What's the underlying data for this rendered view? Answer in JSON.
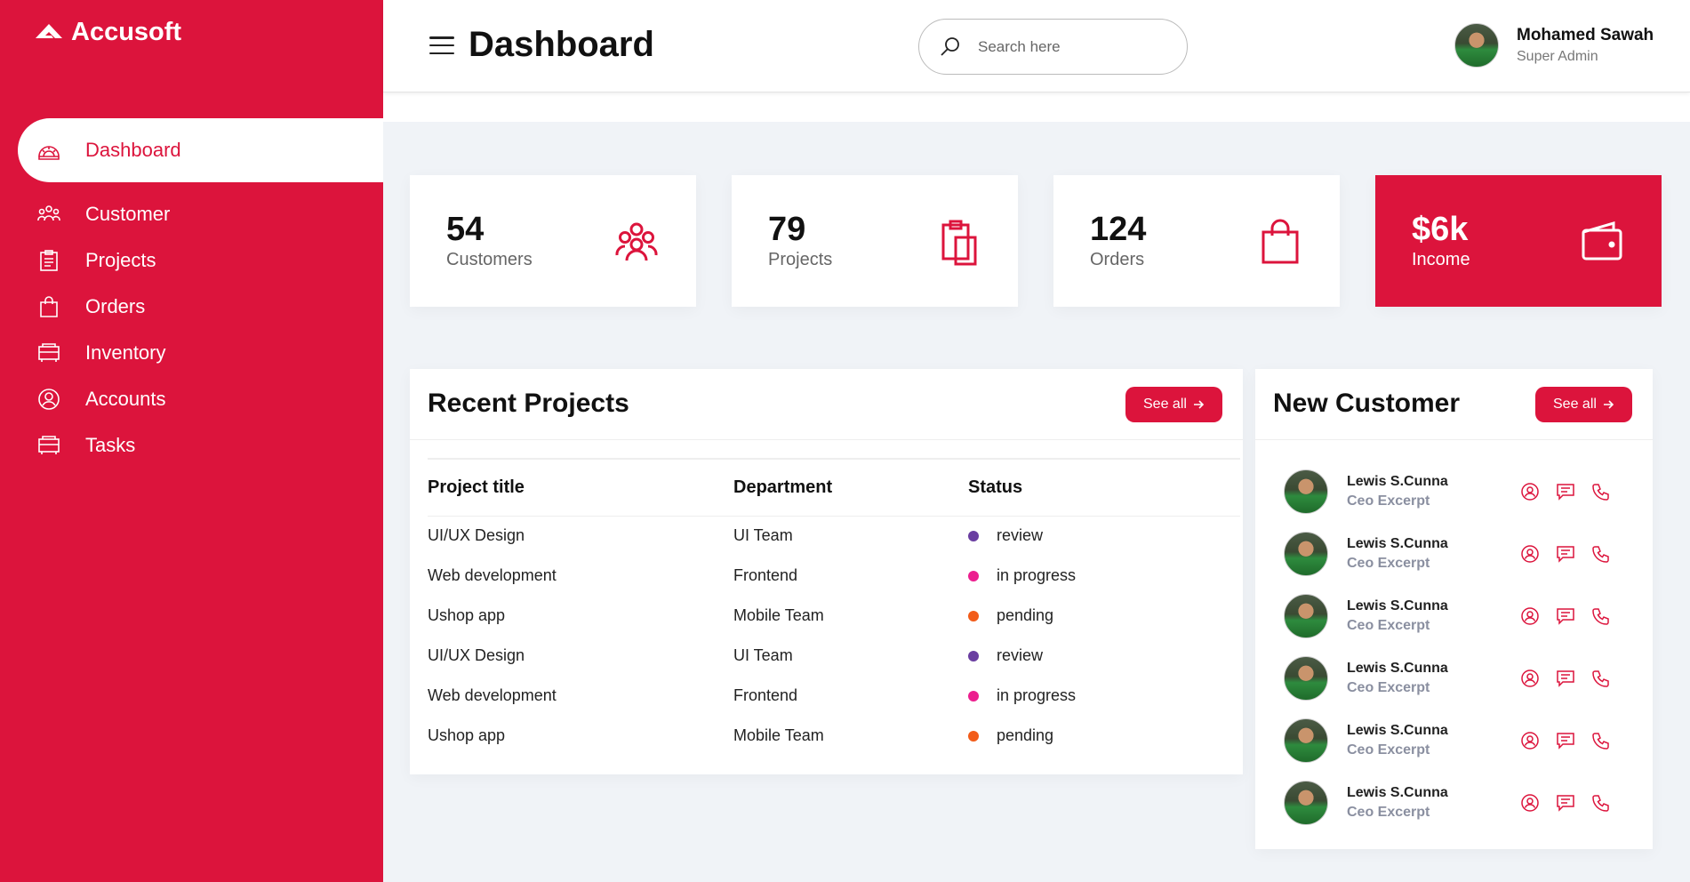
{
  "brand": {
    "name": "Accusoft"
  },
  "colors": {
    "accent": "#dc143c",
    "background": "#f0f3f7"
  },
  "sidebar": {
    "items": [
      {
        "label": "Dashboard",
        "icon": "dashboard-icon",
        "active": true
      },
      {
        "label": "Customer",
        "icon": "customer-icon"
      },
      {
        "label": "Projects",
        "icon": "clipboard-icon"
      },
      {
        "label": "Orders",
        "icon": "bag-icon"
      },
      {
        "label": "Inventory",
        "icon": "inventory-icon"
      },
      {
        "label": "Accounts",
        "icon": "account-icon"
      },
      {
        "label": "Tasks",
        "icon": "tasks-icon"
      }
    ]
  },
  "header": {
    "title": "Dashboard",
    "search_placeholder": "Search here",
    "user": {
      "name": "Mohamed Sawah",
      "role": "Super Admin"
    }
  },
  "cards": [
    {
      "value": "54",
      "label": "Customers",
      "icon": "users-icon"
    },
    {
      "value": "79",
      "label": "Projects",
      "icon": "clipboard-icon"
    },
    {
      "value": "124",
      "label": "Orders",
      "icon": "bag-icon"
    },
    {
      "value": "$6k",
      "label": "Income",
      "icon": "wallet-icon"
    }
  ],
  "recent_projects": {
    "title": "Recent Projects",
    "see_all": "See all",
    "columns": [
      "Project title",
      "Department",
      "Status"
    ],
    "rows": [
      {
        "title": "UI/UX Design",
        "department": "UI Team",
        "status": "review",
        "color": "#6a3ea1"
      },
      {
        "title": "Web development",
        "department": "Frontend",
        "status": "in progress",
        "color": "#ec1f8f"
      },
      {
        "title": "Ushop app",
        "department": "Mobile Team",
        "status": "pending",
        "color": "#f25c19"
      },
      {
        "title": "UI/UX Design",
        "department": "UI Team",
        "status": "review",
        "color": "#6a3ea1"
      },
      {
        "title": "Web development",
        "department": "Frontend",
        "status": "in progress",
        "color": "#ec1f8f"
      },
      {
        "title": "Ushop app",
        "department": "Mobile Team",
        "status": "pending",
        "color": "#f25c19"
      }
    ]
  },
  "new_customer": {
    "title": "New Customer",
    "see_all": "See all",
    "items": [
      {
        "name": "Lewis S.Cunna",
        "role": "Ceo Excerpt"
      },
      {
        "name": "Lewis S.Cunna",
        "role": "Ceo Excerpt"
      },
      {
        "name": "Lewis S.Cunna",
        "role": "Ceo Excerpt"
      },
      {
        "name": "Lewis S.Cunna",
        "role": "Ceo Excerpt"
      },
      {
        "name": "Lewis S.Cunna",
        "role": "Ceo Excerpt"
      },
      {
        "name": "Lewis S.Cunna",
        "role": "Ceo Excerpt"
      }
    ]
  }
}
